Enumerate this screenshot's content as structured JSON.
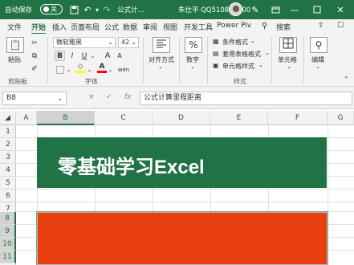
{
  "titlebar": {
    "autosave_label": "自动保存",
    "autosave_state": "关",
    "document_name": "公式计...",
    "user_name": "朱仕平 QQ510809100"
  },
  "tabs": [
    "文件",
    "开始",
    "插入",
    "页面布局",
    "公式",
    "数据",
    "审阅",
    "视图",
    "开发工具",
    "Power Piv"
  ],
  "search_label": "搜索",
  "ribbon": {
    "clipboard": {
      "paste": "粘贴",
      "group": "剪贴板"
    },
    "font": {
      "font_name": "微软雅黑",
      "font_size": "42",
      "bold": "B",
      "italic": "I",
      "underline": "U",
      "grow": "A",
      "shrink": "A",
      "font_color": "A",
      "phonetic": "wén",
      "group": "字体"
    },
    "alignment": {
      "label": "对齐方式"
    },
    "number": {
      "label": "数字",
      "icon_text": "%"
    },
    "styles": {
      "conditional": "条件格式",
      "table": "套用表格格式",
      "cell_styles": "单元格样式",
      "group": "样式"
    },
    "cells": {
      "label": "单元格"
    },
    "editing": {
      "label": "编辑"
    }
  },
  "formula_bar": {
    "name_box": "B8",
    "cancel": "×",
    "enter": "✓",
    "fx": "fx",
    "formula": "公式计算里程距离"
  },
  "columns": [
    "A",
    "B",
    "C",
    "D",
    "E",
    "F",
    "G"
  ],
  "rows": [
    "1",
    "2",
    "3",
    "4",
    "5",
    "6",
    "7",
    "8",
    "9",
    "10",
    "11"
  ],
  "banner_text": "零基础学习Excel",
  "colors": {
    "excel_green": "#217346",
    "red_fill": "#e8400f"
  }
}
